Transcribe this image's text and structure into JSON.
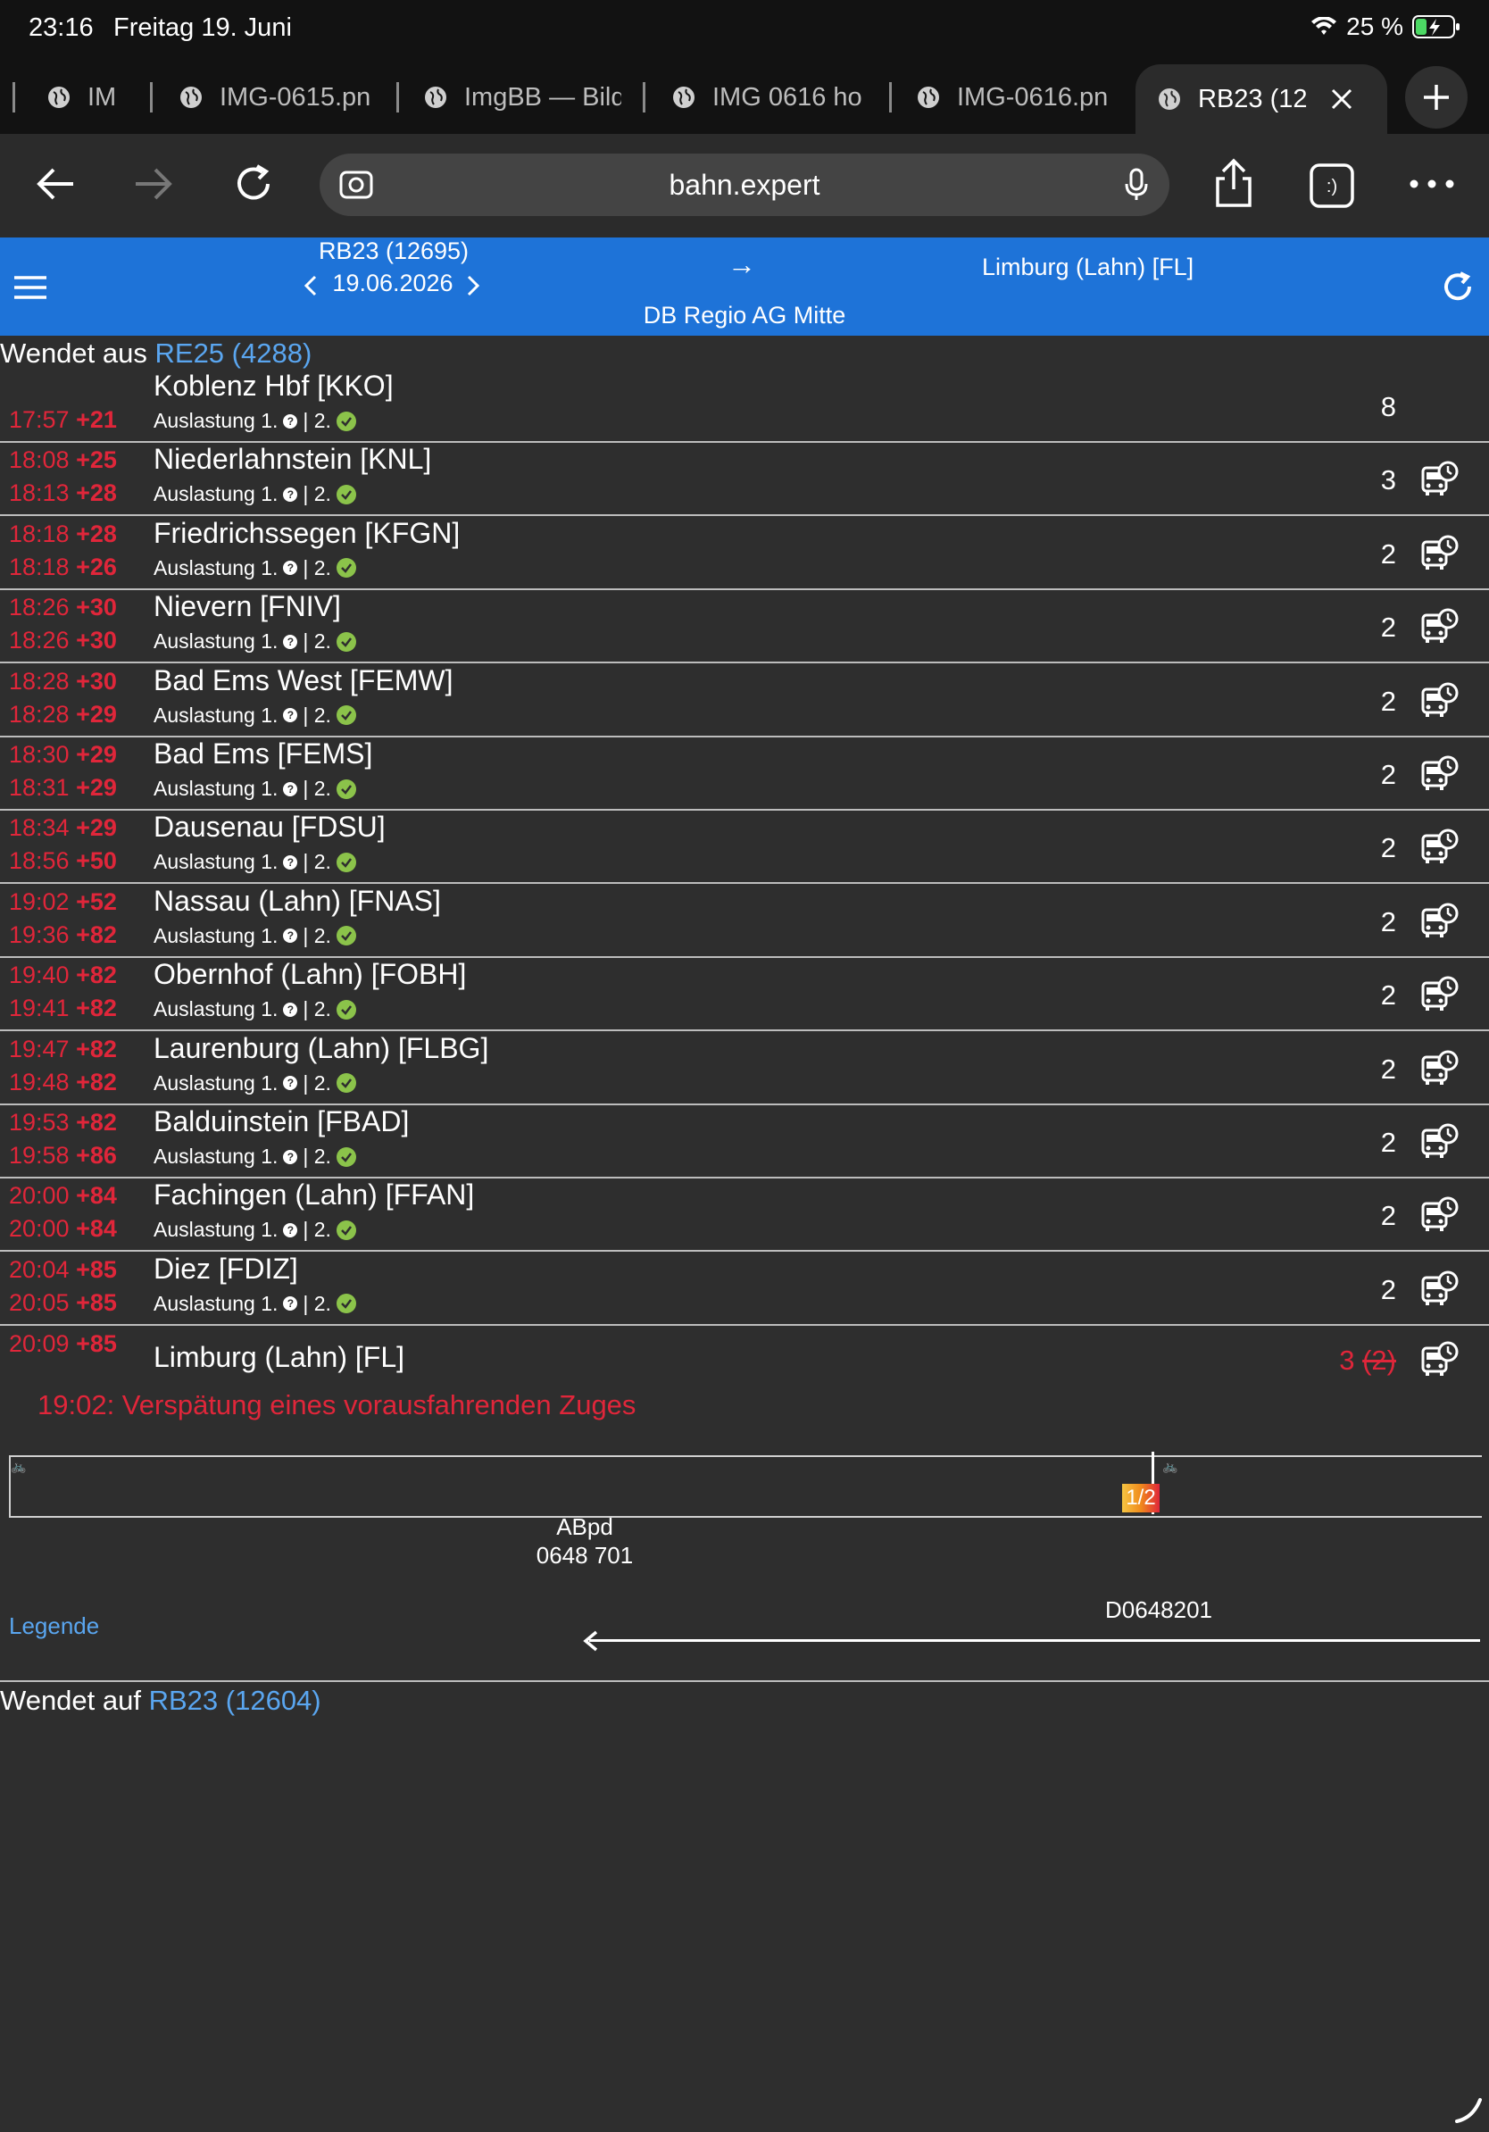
{
  "status": {
    "time": "23:16",
    "date": "Freitag 19. Juni",
    "battery": "25 %"
  },
  "tabs": [
    {
      "label": "IM"
    },
    {
      "label": "IMG-0615.pn"
    },
    {
      "label": "ImgBB — Bild"
    },
    {
      "label": "IMG 0616 ho"
    },
    {
      "label": "IMG-0616.pn"
    },
    {
      "label": "RB23 (12"
    }
  ],
  "browser": {
    "url": "bahn.expert"
  },
  "header": {
    "train": "RB23 (12695)",
    "date": "19.06.2026",
    "arrow": "→",
    "destination": "Limburg (Lahn) [FL]",
    "operator": "DB Regio AG Mitte"
  },
  "wendet_aus": {
    "prefix": "Wendet aus",
    "link": "RE25 (4288)"
  },
  "stops": [
    {
      "name": "Koblenz Hbf [KKO]",
      "dep_time": "17:57",
      "dep_delay": "+21",
      "load": "Auslastung 1.",
      "load2": "| 2.",
      "platform": "8"
    },
    {
      "name": "Niederlahnstein [KNL]",
      "arr_time": "18:08",
      "arr_delay": "+25",
      "dep_time": "18:13",
      "dep_delay": "+28",
      "load": "Auslastung 1.",
      "load2": "| 2.",
      "platform": "3"
    },
    {
      "name": "Friedrichssegen [KFGN]",
      "arr_time": "18:18",
      "arr_delay": "+28",
      "dep_time": "18:18",
      "dep_delay": "+26",
      "load": "Auslastung 1.",
      "load2": "| 2.",
      "platform": "2"
    },
    {
      "name": "Nievern [FNIV]",
      "arr_time": "18:26",
      "arr_delay": "+30",
      "dep_time": "18:26",
      "dep_delay": "+30",
      "load": "Auslastung 1.",
      "load2": "| 2.",
      "platform": "2"
    },
    {
      "name": "Bad Ems West [FEMW]",
      "arr_time": "18:28",
      "arr_delay": "+30",
      "dep_time": "18:28",
      "dep_delay": "+29",
      "load": "Auslastung 1.",
      "load2": "| 2.",
      "platform": "2"
    },
    {
      "name": "Bad Ems [FEMS]",
      "arr_time": "18:30",
      "arr_delay": "+29",
      "dep_time": "18:31",
      "dep_delay": "+29",
      "load": "Auslastung 1.",
      "load2": "| 2.",
      "platform": "2"
    },
    {
      "name": "Dausenau [FDSU]",
      "arr_time": "18:34",
      "arr_delay": "+29",
      "dep_time": "18:56",
      "dep_delay": "+50",
      "load": "Auslastung 1.",
      "load2": "| 2.",
      "platform": "2"
    },
    {
      "name": "Nassau (Lahn) [FNAS]",
      "arr_time": "19:02",
      "arr_delay": "+52",
      "dep_time": "19:36",
      "dep_delay": "+82",
      "load": "Auslastung 1.",
      "load2": "| 2.",
      "platform": "2"
    },
    {
      "name": "Obernhof (Lahn) [FOBH]",
      "arr_time": "19:40",
      "arr_delay": "+82",
      "dep_time": "19:41",
      "dep_delay": "+82",
      "load": "Auslastung 1.",
      "load2": "| 2.",
      "platform": "2"
    },
    {
      "name": "Laurenburg (Lahn) [FLBG]",
      "arr_time": "19:47",
      "arr_delay": "+82",
      "dep_time": "19:48",
      "dep_delay": "+82",
      "load": "Auslastung 1.",
      "load2": "| 2.",
      "platform": "2"
    },
    {
      "name": "Balduinstein [FBAD]",
      "arr_time": "19:53",
      "arr_delay": "+82",
      "dep_time": "19:58",
      "dep_delay": "+86",
      "load": "Auslastung 1.",
      "load2": "| 2.",
      "platform": "2"
    },
    {
      "name": "Fachingen (Lahn) [FFAN]",
      "arr_time": "20:00",
      "arr_delay": "+84",
      "dep_time": "20:00",
      "dep_delay": "+84",
      "load": "Auslastung 1.",
      "load2": "| 2.",
      "platform": "2"
    },
    {
      "name": "Diez [FDIZ]",
      "arr_time": "20:04",
      "arr_delay": "+85",
      "dep_time": "20:05",
      "dep_delay": "+85",
      "load": "Auslastung 1.",
      "load2": "| 2.",
      "platform": "2"
    }
  ],
  "final_stop": {
    "name": "Limburg (Lahn) [FL]",
    "arr_time": "20:09",
    "arr_delay": "+85",
    "platform": "3",
    "platform_old": "(2)"
  },
  "reason": "19:02: Verspätung eines vorausfahrenden Zuges",
  "wagon": {
    "type": "ABpd",
    "number": "0648 701",
    "badge": "1/2",
    "train_no": "D0648201"
  },
  "legende": "Legende",
  "wendet_auf": {
    "prefix": "Wendet auf",
    "link": "RB23 (12604)"
  },
  "colors": {
    "header": "#1e73d8",
    "delay": "#e0263a",
    "link": "#5aa6f0",
    "background": "#2e2e2e"
  }
}
